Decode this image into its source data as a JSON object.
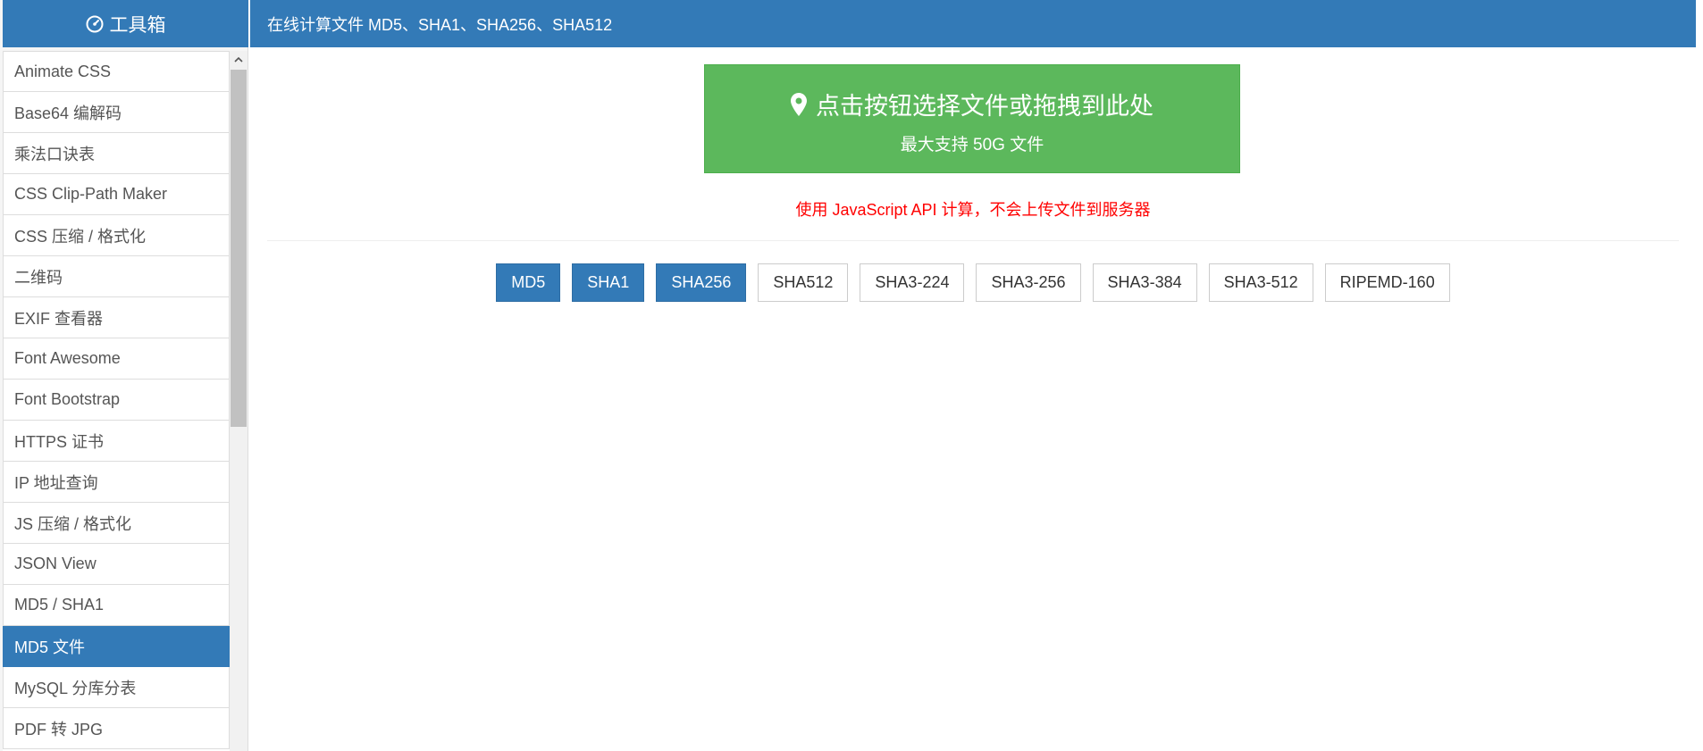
{
  "sidebar": {
    "title": "工具箱",
    "items": [
      {
        "label": "Animate CSS",
        "active": false
      },
      {
        "label": "Base64 编解码",
        "active": false
      },
      {
        "label": "乘法口诀表",
        "active": false
      },
      {
        "label": "CSS Clip-Path Maker",
        "active": false
      },
      {
        "label": "CSS 压缩 / 格式化",
        "active": false
      },
      {
        "label": "二维码",
        "active": false
      },
      {
        "label": "EXIF 查看器",
        "active": false
      },
      {
        "label": "Font Awesome",
        "active": false
      },
      {
        "label": "Font Bootstrap",
        "active": false
      },
      {
        "label": "HTTPS 证书",
        "active": false
      },
      {
        "label": "IP 地址查询",
        "active": false
      },
      {
        "label": "JS 压缩 / 格式化",
        "active": false
      },
      {
        "label": "JSON View",
        "active": false
      },
      {
        "label": "MD5 / SHA1",
        "active": false
      },
      {
        "label": "MD5 文件",
        "active": true
      },
      {
        "label": "MySQL 分库分表",
        "active": false
      },
      {
        "label": "PDF 转 JPG",
        "active": false
      }
    ]
  },
  "header": {
    "title": "在线计算文件 MD5、SHA1、SHA256、SHA512"
  },
  "upload": {
    "title": "点击按钮选择文件或拖拽到此处",
    "subtitle": "最大支持 50G 文件"
  },
  "notice": "使用 JavaScript API 计算，不会上传文件到服务器",
  "algorithms": [
    {
      "label": "MD5",
      "selected": true
    },
    {
      "label": "SHA1",
      "selected": true
    },
    {
      "label": "SHA256",
      "selected": true
    },
    {
      "label": "SHA512",
      "selected": false
    },
    {
      "label": "SHA3-224",
      "selected": false
    },
    {
      "label": "SHA3-256",
      "selected": false
    },
    {
      "label": "SHA3-384",
      "selected": false
    },
    {
      "label": "SHA3-512",
      "selected": false
    },
    {
      "label": "RIPEMD-160",
      "selected": false
    }
  ],
  "colors": {
    "primary": "#337ab7",
    "success": "#5cb85c",
    "danger": "#ff0000"
  },
  "icons": {
    "sidebar_title": "gauge-icon",
    "upload": "map-marker-icon",
    "scroll_up": "chevron-up-icon"
  }
}
